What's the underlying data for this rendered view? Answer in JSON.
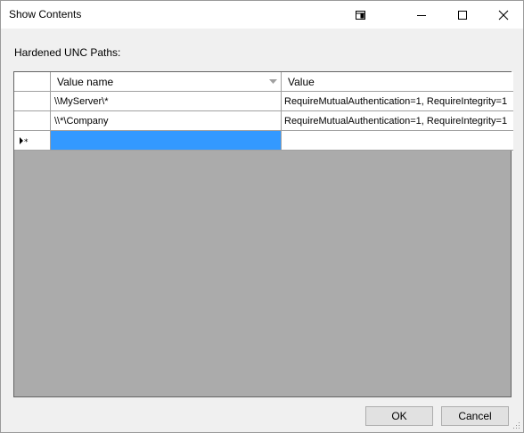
{
  "window": {
    "title": "Show Contents"
  },
  "titlebar_icons": {
    "snap": "snap-layout-icon",
    "minimize": "minimize-icon",
    "maximize": "maximize-icon",
    "close": "close-icon"
  },
  "section_label": "Hardened UNC Paths:",
  "table": {
    "columns": [
      "Value name",
      "Value"
    ],
    "rows": [
      {
        "name": "\\\\MyServer\\*",
        "value": "RequireMutualAuthentication=1, RequireIntegrity=1"
      },
      {
        "name": "\\\\*\\Company",
        "value": "RequireMutualAuthentication=1, RequireIntegrity=1"
      }
    ],
    "new_row": {
      "name": "",
      "value": ""
    },
    "new_row_marker": "▸*"
  },
  "buttons": {
    "ok": "OK",
    "cancel": "Cancel"
  },
  "colors": {
    "selection": "#3399ff",
    "grid_background": "#ababab",
    "window_background": "#f0f0f0"
  }
}
